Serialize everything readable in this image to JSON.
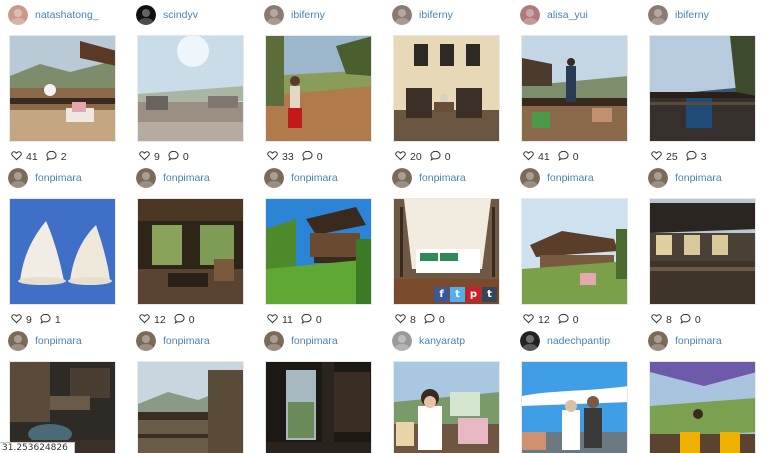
{
  "colors": {
    "username": "#4a84b5",
    "facebook": "#3b5998",
    "twitter": "#55acee",
    "pinterest": "#cb2027",
    "tumblr": "#35465c"
  },
  "posts": [
    {
      "username": "natashatong_",
      "likes": "41",
      "comments": "2",
      "scene": "terrace-valley",
      "avatar": "#c99a8a"
    },
    {
      "username": "scindyv",
      "likes": "9",
      "comments": "0",
      "scene": "deck-hazy",
      "avatar": "#111111"
    },
    {
      "username": "ibiferny",
      "likes": "33",
      "comments": "0",
      "scene": "girl-field",
      "avatar": "#8a7a70"
    },
    {
      "username": "ibiferny",
      "likes": "20",
      "comments": "0",
      "scene": "room-chairs",
      "avatar": "#8a7a70"
    },
    {
      "username": "alisa_yui",
      "likes": "41",
      "comments": "0",
      "scene": "man-balcony",
      "avatar": "#b07a7a"
    },
    {
      "username": "ibiferny",
      "likes": "25",
      "comments": "3",
      "scene": "balcony-chair",
      "avatar": "#8a7a70"
    },
    {
      "username": "fonpimara",
      "likes": "9",
      "comments": "1",
      "scene": "dumplings",
      "avatar": "#7a6a58"
    },
    {
      "username": "fonpimara",
      "likes": "12",
      "comments": "0",
      "scene": "teak-interior",
      "avatar": "#7a6a58"
    },
    {
      "username": "fonpimara",
      "likes": "11",
      "comments": "0",
      "scene": "treehouse",
      "avatar": "#7a6a58"
    },
    {
      "username": "fonpimara",
      "likes": "8",
      "comments": "0",
      "scene": "canopy-bed",
      "avatar": "#7a6a58",
      "share": [
        "f",
        "t",
        "p",
        "t"
      ]
    },
    {
      "username": "fonpimara",
      "likes": "12",
      "comments": "0",
      "scene": "house-garden",
      "avatar": "#7a6a58"
    },
    {
      "username": "fonpimara",
      "likes": "8",
      "comments": "0",
      "scene": "dark-pavilion",
      "avatar": "#7a6a58"
    },
    {
      "username": "fonpimara",
      "likes": "",
      "comments": "",
      "scene": "dark-bath",
      "avatar": "#7a6a58"
    },
    {
      "username": "fonpimara",
      "likes": "",
      "comments": "",
      "scene": "deck-mountain",
      "avatar": "#7a6a58"
    },
    {
      "username": "fonpimara",
      "likes": "",
      "comments": "",
      "scene": "dark-window",
      "avatar": "#7a6a58"
    },
    {
      "username": "kanyaratp",
      "likes": "",
      "comments": "",
      "scene": "woman-cushions",
      "avatar": "#9a9a9a"
    },
    {
      "username": "nadechpantip",
      "likes": "",
      "comments": "",
      "scene": "couple-pool",
      "avatar": "#222222"
    },
    {
      "username": "fonpimara",
      "likes": "",
      "comments": "",
      "scene": "umbrella-terrace",
      "avatar": "#7a6a58"
    }
  ],
  "status_bar": {
    "coords": "31.253624826"
  }
}
